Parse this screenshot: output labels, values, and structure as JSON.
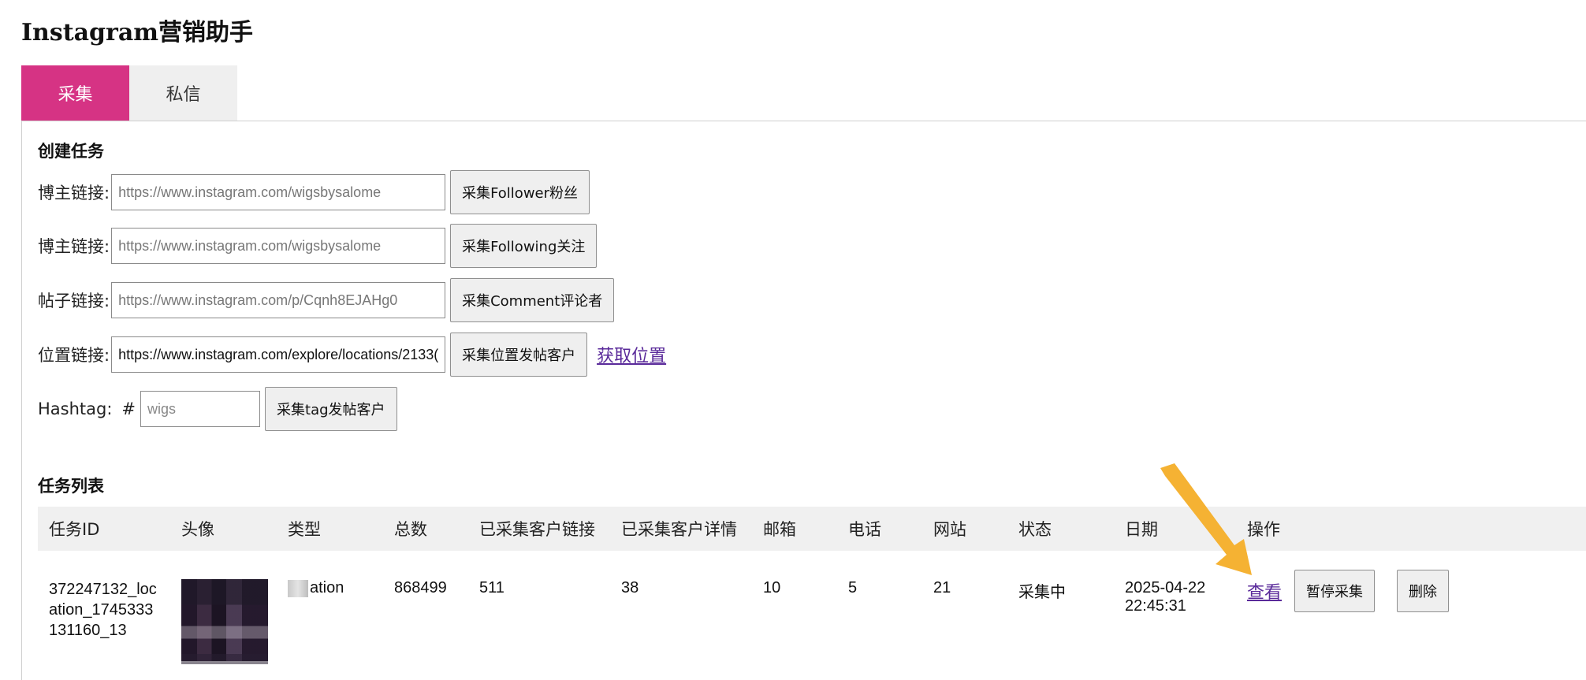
{
  "app_title": "Instagram营销助手",
  "tabs": [
    {
      "label": "采集",
      "active": true
    },
    {
      "label": "私信",
      "active": false
    }
  ],
  "create_task": {
    "title": "创建任务",
    "rows": [
      {
        "label": "博主链接:",
        "placeholder": "https://www.instagram.com/wigsbysalome",
        "value": "",
        "button": "采集Follower粉丝"
      },
      {
        "label": "博主链接:",
        "placeholder": "https://www.instagram.com/wigsbysalome",
        "value": "",
        "button": "采集Following关注"
      },
      {
        "label": "帖子链接:",
        "placeholder": "https://www.instagram.com/p/Cqnh8EJAHg0",
        "value": "",
        "button": "采集Comment评论者"
      },
      {
        "label": "位置链接:",
        "placeholder": "",
        "value": "https://www.instagram.com/explore/locations/2133(",
        "button": "采集位置发帖客户",
        "link": "获取位置"
      }
    ],
    "hashtag": {
      "label": "Hashtag:",
      "hash": "#",
      "placeholder": "wigs",
      "button": "采集tag发帖客户"
    }
  },
  "task_list": {
    "title": "任务列表",
    "columns": [
      "任务ID",
      "头像",
      "类型",
      "总数",
      "已采集客户链接",
      "已采集客户详情",
      "邮箱",
      "电话",
      "网站",
      "状态",
      "日期",
      "操作"
    ],
    "rows": [
      {
        "id": "372247132_location_1745333131160_13",
        "type": "ation",
        "total": "868499",
        "links": "511",
        "details": "38",
        "email": "10",
        "phone": "5",
        "website": "21",
        "status": "采集中",
        "date": "2025-04-22",
        "time": "22:45:31",
        "actions": {
          "view": "查看",
          "pause": "暂停采集",
          "delete": "删除"
        }
      }
    ]
  },
  "colors": {
    "accent": "#d63384",
    "arrow": "#f5b233",
    "link": "#5a2a9a"
  }
}
